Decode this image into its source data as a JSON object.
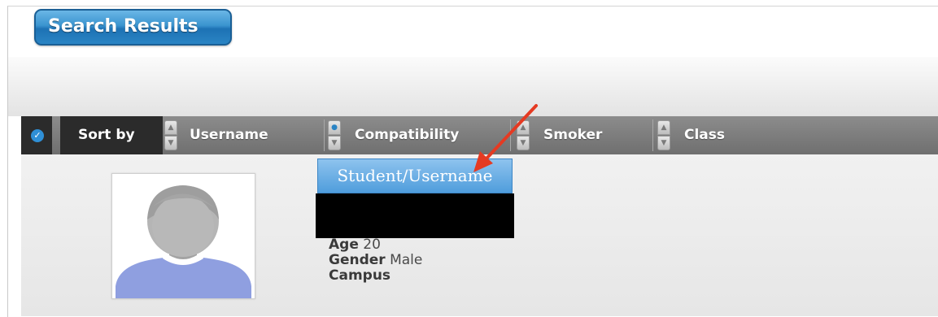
{
  "header": {
    "title": "Search Results"
  },
  "sort_bar": {
    "sort_by_label": "Sort by",
    "columns": [
      {
        "label": "Username",
        "active": false
      },
      {
        "label": "Compatibility",
        "active": true
      },
      {
        "label": "Smoker",
        "active": false
      },
      {
        "label": "Class",
        "active": false
      }
    ]
  },
  "dropdown": {
    "selected": "Student/Username"
  },
  "result": {
    "age_label": "Age",
    "age_value": "20",
    "gender_label": "Gender",
    "gender_value": "Male",
    "campus_label": "Campus",
    "campus_value": ""
  },
  "colors": {
    "accent": "#2a84c4",
    "annotation_arrow": "#e53a22"
  },
  "icons": [
    "check-icon",
    "sort-up-icon",
    "sort-down-icon",
    "avatar-placeholder-icon"
  ]
}
